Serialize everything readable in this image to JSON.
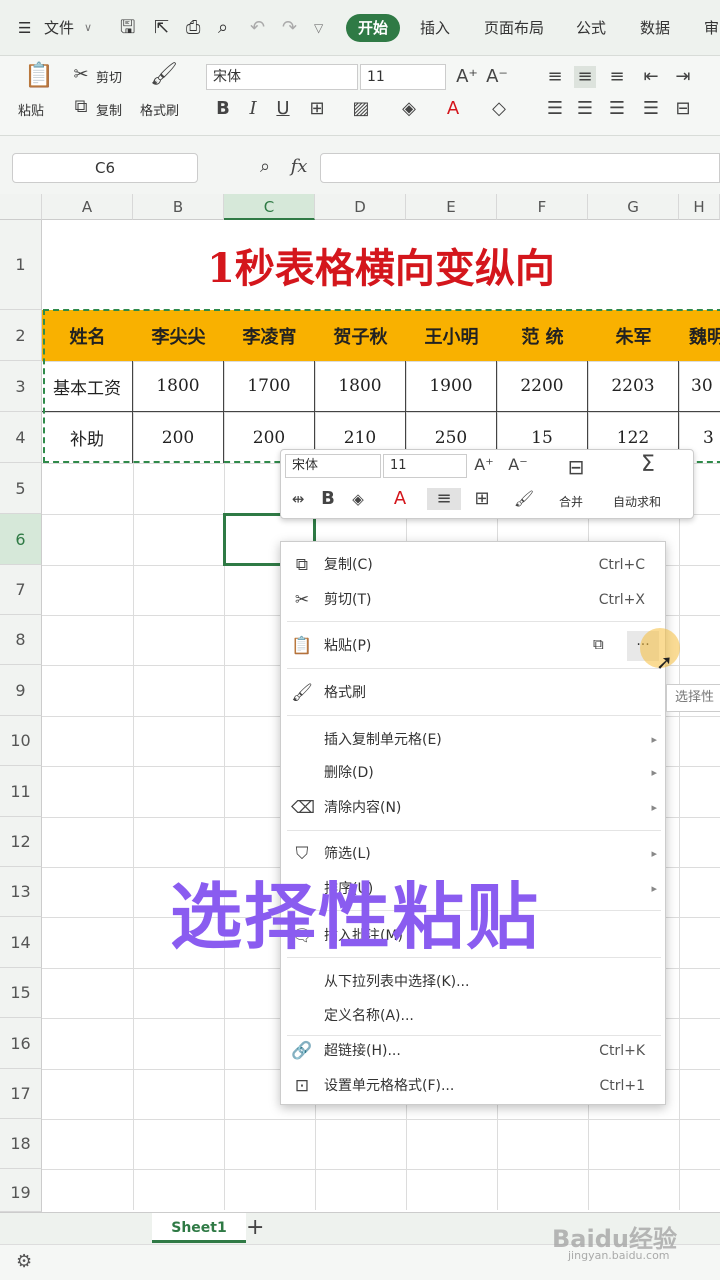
{
  "menubar": {
    "menu": "文件",
    "tabs": [
      "开始",
      "插入",
      "页面布局",
      "公式",
      "数据",
      "审"
    ]
  },
  "ribbon": {
    "paste": "粘贴",
    "cut": "剪切",
    "copy": "复制",
    "format_painter": "格式刷",
    "font_name": "宋体",
    "font_size": "11",
    "bold": "B",
    "italic": "I",
    "underline": "U"
  },
  "formula": {
    "name_box": "C6",
    "fx": "fx"
  },
  "columns": [
    "A",
    "B",
    "C",
    "D",
    "E",
    "F",
    "G",
    "H"
  ],
  "rows": [
    "1",
    "2",
    "3",
    "4",
    "5",
    "6",
    "7",
    "8",
    "9",
    "10",
    "11",
    "12",
    "13",
    "14",
    "15",
    "16",
    "17",
    "18",
    "19"
  ],
  "sheet": {
    "title": "1秒表格横向变纵向",
    "header_row": [
      "姓名",
      "李尖尖",
      "李凌宵",
      "贺子秋",
      "王小明",
      "范  统",
      "朱军",
      "魏明"
    ],
    "row3": [
      "基本工资",
      "1800",
      "1700",
      "1800",
      "1900",
      "2200",
      "2203",
      "30"
    ],
    "row4": [
      "补助",
      "200",
      "200",
      "210",
      "250",
      "15",
      "122",
      "3"
    ]
  },
  "minibar": {
    "font": "宋体",
    "size": "11",
    "merge": "合并",
    "autosum": "自动求和"
  },
  "context_menu": [
    {
      "label": "复制(C)",
      "shortcut": "Ctrl+C",
      "icon": "copy-icon"
    },
    {
      "label": "剪切(T)",
      "shortcut": "Ctrl+X",
      "icon": "scissors-icon"
    },
    {
      "label": "粘贴(P)",
      "shortcut": "",
      "icon": "paste-icon"
    },
    {
      "label": "格式刷",
      "shortcut": "",
      "icon": "brush-icon"
    },
    {
      "label": "插入复制单元格(E)",
      "shortcut": "",
      "icon": ""
    },
    {
      "label": "删除(D)",
      "shortcut": "",
      "icon": ""
    },
    {
      "label": "清除内容(N)",
      "shortcut": "",
      "icon": "eraser-icon"
    },
    {
      "label": "筛选(L)",
      "shortcut": "",
      "icon": "filter-icon"
    },
    {
      "label": "排序(U)",
      "shortcut": "",
      "icon": ""
    },
    {
      "label": "插入批注(M)",
      "shortcut": "",
      "icon": "comment-icon"
    },
    {
      "label": "从下拉列表中选择(K)...",
      "shortcut": "",
      "icon": ""
    },
    {
      "label": "定义名称(A)...",
      "shortcut": "",
      "icon": ""
    },
    {
      "label": "超链接(H)...",
      "shortcut": "Ctrl+K",
      "icon": "link-icon"
    },
    {
      "label": "设置单元格格式(F)...",
      "shortcut": "Ctrl+1",
      "icon": "format-cells-icon"
    }
  ],
  "paste_more": "···",
  "tooltip": "选择性",
  "overlay_text": "选择性粘贴",
  "sheet_tab": "Sheet1",
  "watermark": "Baidu经验",
  "watermark_url": "jingyan.baidu.com"
}
